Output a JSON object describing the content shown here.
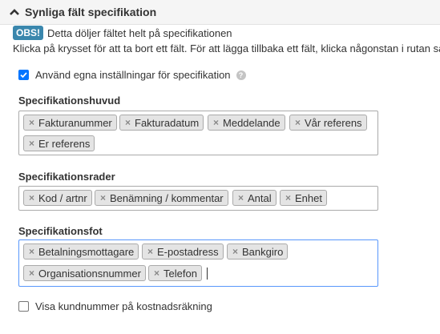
{
  "section": {
    "title": "Synliga fält specifikation"
  },
  "notice": {
    "badge": "OBS!",
    "text": "Detta döljer fältet helt på specifikationen",
    "help": "Klicka på krysset för att ta bort ett fält. För att lägga tillbaka ett fält, klicka någonstan i rutan så"
  },
  "custom_settings": {
    "label": "Använd egna inställningar för specifikation",
    "checked": true,
    "help_icon": "question-circle-icon"
  },
  "header_field": {
    "label": "Specifikationshuvud",
    "tags": [
      "Fakturanummer",
      "Fakturadatum",
      "Meddelande",
      "Vår referens",
      "Er referens"
    ]
  },
  "rows_field": {
    "label": "Specifikationsrader",
    "tags": [
      "Kod / artnr",
      "Benämning / kommentar",
      "Antal",
      "Enhet"
    ]
  },
  "footer_field": {
    "label": "Specifikationsfot",
    "tags": [
      "Betalningsmottagare",
      "E-postadress",
      "Bankgiro",
      "Organisationsnummer",
      "Telefon"
    ]
  },
  "customer_number": {
    "label": "Visa kundnummer på kostnadsräkning",
    "checked": false
  },
  "remove_icon": "close-icon",
  "colors": {
    "accent": "#0075ff",
    "badge": "#3a87ad",
    "tag_bg": "#e4e4e4",
    "focus_border": "#5897fb"
  }
}
